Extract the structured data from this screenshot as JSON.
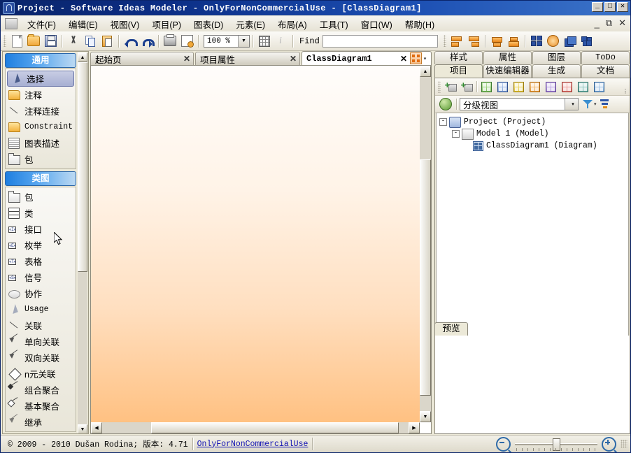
{
  "window": {
    "title": "Project - Software Ideas Modeler - OnlyForNonCommercialUse - [ClassDiagram1]",
    "minimize": "_",
    "maximize": "□",
    "close": "✕",
    "doc_minimize": "_",
    "doc_restore": "⧉",
    "doc_close": "✕"
  },
  "menubar": {
    "items": [
      {
        "label": "文件(F)"
      },
      {
        "label": "编辑(E)"
      },
      {
        "label": "视图(V)"
      },
      {
        "label": "项目(P)"
      },
      {
        "label": "图表(D)"
      },
      {
        "label": "元素(E)"
      },
      {
        "label": "布局(A)"
      },
      {
        "label": "工具(T)"
      },
      {
        "label": "窗口(W)"
      },
      {
        "label": "帮助(H)"
      }
    ]
  },
  "toolbar": {
    "zoom_value": "100 %",
    "find_label": "Find",
    "find_value": "",
    "find_placeholder": "",
    "buttons": [
      {
        "name": "new-document",
        "icon": "document-icon"
      },
      {
        "name": "open",
        "icon": "open-folder-icon"
      },
      {
        "name": "save",
        "icon": "floppy-save-icon"
      },
      {
        "name": "cut",
        "icon": "scissors-icon"
      },
      {
        "name": "copy",
        "icon": "copy-icon"
      },
      {
        "name": "paste",
        "icon": "clipboard-paste-icon"
      },
      {
        "name": "undo",
        "icon": "undo-arrow-icon"
      },
      {
        "name": "redo",
        "icon": "redo-arrow-icon"
      },
      {
        "name": "print",
        "icon": "printer-icon"
      },
      {
        "name": "print-preview",
        "icon": "print-preview-icon"
      },
      {
        "name": "grid",
        "icon": "grid-icon"
      },
      {
        "name": "info",
        "icon": "info-icon"
      }
    ],
    "right_buttons": [
      {
        "name": "align-left",
        "icon": "align-left-icon"
      },
      {
        "name": "align-right",
        "icon": "align-right-icon"
      },
      {
        "name": "distribute-top",
        "icon": "distribute-top-icon"
      },
      {
        "name": "distribute-bottom",
        "icon": "distribute-bottom-icon"
      },
      {
        "name": "tile-windows",
        "icon": "tile-windows-icon"
      },
      {
        "name": "settings",
        "icon": "gear-icon"
      },
      {
        "name": "layers",
        "icon": "layers-icon"
      },
      {
        "name": "components",
        "icon": "components-icon"
      }
    ]
  },
  "palette": {
    "groups": [
      {
        "header": "通用",
        "items": [
          {
            "label": "选择",
            "icon": "cursor-select-icon",
            "selected": true
          },
          {
            "label": "注释",
            "icon": "note-icon",
            "selected": false
          },
          {
            "label": "注释连接",
            "icon": "note-link-icon",
            "selected": false
          },
          {
            "label": "Constraint",
            "icon": "constraint-icon",
            "selected": false,
            "mono": true
          },
          {
            "label": "图表描述",
            "icon": "diagram-description-icon",
            "selected": false
          },
          {
            "label": "包",
            "icon": "package-icon",
            "selected": false
          }
        ]
      },
      {
        "header": "类图",
        "items": [
          {
            "label": "包",
            "icon": "package-icon",
            "selected": false
          },
          {
            "label": "类",
            "icon": "class-icon",
            "selected": false
          },
          {
            "label": "接口",
            "icon": "interface-icon",
            "selected": false,
            "stereo": "«I»"
          },
          {
            "label": "枚举",
            "icon": "enumeration-icon",
            "selected": false,
            "stereo": "«E»"
          },
          {
            "label": "表格",
            "icon": "table-icon",
            "selected": false,
            "stereo": "«T»"
          },
          {
            "label": "信号",
            "icon": "signal-icon",
            "selected": false,
            "stereo": "«S»"
          },
          {
            "label": "协作",
            "icon": "collaboration-icon",
            "selected": false
          },
          {
            "label": "Usage",
            "icon": "usage-icon",
            "selected": false,
            "mono": true
          },
          {
            "label": "关联",
            "icon": "association-icon",
            "selected": false
          },
          {
            "label": "单向关联",
            "icon": "directed-association-icon",
            "selected": false
          },
          {
            "label": "双向关联",
            "icon": "bidirectional-association-icon",
            "selected": false
          },
          {
            "label": "n元关联",
            "icon": "nary-association-icon",
            "selected": false
          },
          {
            "label": "组合聚合",
            "icon": "composition-icon",
            "selected": false
          },
          {
            "label": "基本聚合",
            "icon": "aggregation-icon",
            "selected": false
          },
          {
            "label": "继承",
            "icon": "generalization-icon",
            "selected": false
          }
        ]
      }
    ],
    "scroll_up": "▲",
    "scroll_down": "▼"
  },
  "documents": {
    "tabs": [
      {
        "label": "起始页",
        "close": "✕",
        "active": false,
        "mono": false
      },
      {
        "label": "项目属性",
        "close": "✕",
        "active": false,
        "mono": false
      },
      {
        "label": "ClassDiagram1",
        "close": "✕",
        "active": true,
        "mono": true
      }
    ],
    "tab_menu_caret": "▾"
  },
  "canvas": {
    "scroll_up": "▲",
    "scroll_down": "▼",
    "scroll_left": "◀",
    "scroll_right": "▶"
  },
  "right_panel": {
    "tabs_row1": [
      {
        "label": "样式",
        "active": false,
        "mono": false
      },
      {
        "label": "属性",
        "active": false,
        "mono": false
      },
      {
        "label": "图层",
        "active": false,
        "mono": false
      },
      {
        "label": "ToDo",
        "active": false,
        "mono": true
      }
    ],
    "tabs_row2": [
      {
        "label": "项目",
        "active": true,
        "mono": false
      },
      {
        "label": "快速编辑器",
        "active": false,
        "mono": false
      },
      {
        "label": "生成",
        "active": false,
        "mono": false
      },
      {
        "label": "文档",
        "active": false,
        "mono": false
      }
    ],
    "toolbar": {
      "add_buttons": [
        {
          "name": "add-model-icon"
        },
        {
          "name": "add-diagram-icon"
        }
      ],
      "diagram_icons": [
        {
          "name": "use-case-diagram-icon",
          "color": "#4e9b3c"
        },
        {
          "name": "class-diagram-icon",
          "color": "#4a6fb5"
        },
        {
          "name": "activity-diagram-icon",
          "color": "#c9a216"
        },
        {
          "name": "component-diagram-icon",
          "color": "#d4801e"
        },
        {
          "name": "state-diagram-icon",
          "color": "#7b56b5"
        },
        {
          "name": "sequence-diagram-icon",
          "color": "#c4443c"
        },
        {
          "name": "deployment-diagram-icon",
          "color": "#3f8c82"
        },
        {
          "name": "package-diagram-icon",
          "color": "#3f7ab5"
        }
      ],
      "overflow": "⋮"
    },
    "filter": {
      "refresh_icon": "refresh-icon",
      "view_mode": "分级视图",
      "caret": "▾",
      "funnel_icon": "filter-funnel-icon",
      "funnel_caret": "▾",
      "sort_icon": "sort-tree-icon"
    },
    "tree": [
      {
        "label": "Project  (Project)",
        "depth": 0,
        "expander": "-",
        "icon": "project-icon"
      },
      {
        "label": "Model 1  (Model)",
        "depth": 1,
        "expander": "-",
        "icon": "model-icon"
      },
      {
        "label": "ClassDiagram1  (Diagram)",
        "depth": 2,
        "expander": "",
        "icon": "diagram-icon"
      }
    ],
    "preview": {
      "tab_label": "预览"
    }
  },
  "statusbar": {
    "copyright": "© 2009 - 2010 Dušan Rodina; 版本: 4.71",
    "license": "OnlyForNonCommercialUse",
    "zoom_out_icon": "zoom-out-icon",
    "zoom_in_icon": "zoom-in-icon"
  },
  "colors": {
    "title_bar": "#0a246a",
    "accent_blue": "#1f7fe0",
    "canvas_top": "#fffdfb",
    "canvas_bottom": "#ffc182",
    "panel_bg": "#ece9d8",
    "link": "#1414b4"
  }
}
